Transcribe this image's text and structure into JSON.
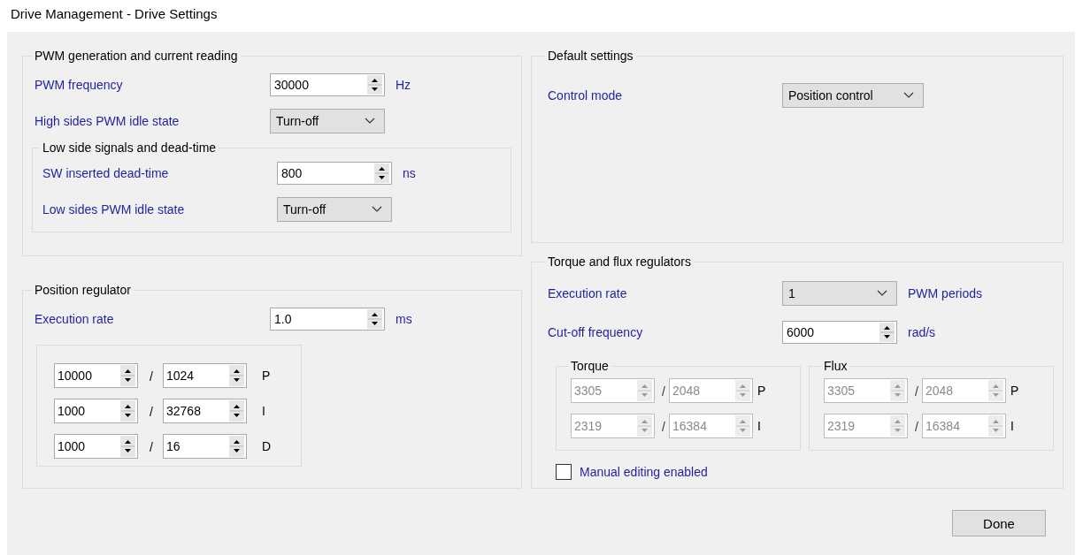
{
  "window": {
    "title": "Drive Management - Drive Settings"
  },
  "pwm_group": {
    "title": "PWM generation and current reading",
    "rows": [
      {
        "kind": "spin",
        "label": "PWM frequency",
        "value": "30000",
        "unit": "Hz"
      },
      {
        "kind": "combo",
        "label": "High sides PWM idle state",
        "value": "Turn-off"
      }
    ],
    "subgroup": {
      "title": "Low side signals and dead-time",
      "rows": [
        {
          "kind": "spin",
          "label": "SW inserted dead-time",
          "value": "800",
          "unit": "ns"
        },
        {
          "kind": "combo",
          "label": "Low sides PWM idle state",
          "value": "Turn-off"
        }
      ]
    }
  },
  "position_regulator": {
    "title": "Position regulator",
    "rows": [
      {
        "kind": "spin",
        "label": "Execution rate",
        "value": "1.0",
        "unit": "ms"
      }
    ],
    "gains": {
      "disabled": false,
      "rows": [
        {
          "numerator": "10000",
          "separator": "/",
          "denominator": "1024",
          "term": "P"
        },
        {
          "numerator": "1000",
          "separator": "/",
          "denominator": "32768",
          "term": "I"
        },
        {
          "numerator": "1000",
          "separator": "/",
          "denominator": "16",
          "term": "D"
        }
      ]
    }
  },
  "default_settings": {
    "title": "Default settings",
    "rows": [
      {
        "kind": "combo",
        "label": "Control mode",
        "value": "Position control"
      }
    ]
  },
  "torque_flux": {
    "title": "Torque and flux regulators",
    "rows": [
      {
        "kind": "combo",
        "label": "Execution rate",
        "value": "1",
        "unit": "PWM periods"
      },
      {
        "kind": "spin",
        "label": "Cut-off frequency",
        "value": "6000",
        "unit": "rad/s"
      }
    ],
    "panels": [
      {
        "title": "Torque",
        "disabled": true,
        "rows": [
          {
            "numerator": "3305",
            "separator": "/",
            "denominator": "2048",
            "term": "P"
          },
          {
            "numerator": "2319",
            "separator": "/",
            "denominator": "16384",
            "term": "I"
          }
        ]
      },
      {
        "title": "Flux",
        "disabled": true,
        "rows": [
          {
            "numerator": "3305",
            "separator": "/",
            "denominator": "2048",
            "term": "P"
          },
          {
            "numerator": "2319",
            "separator": "/",
            "denominator": "16384",
            "term": "I"
          }
        ]
      }
    ],
    "manual_editing": {
      "label": "Manual editing enabled",
      "checked": false
    }
  },
  "done_button": "Done"
}
